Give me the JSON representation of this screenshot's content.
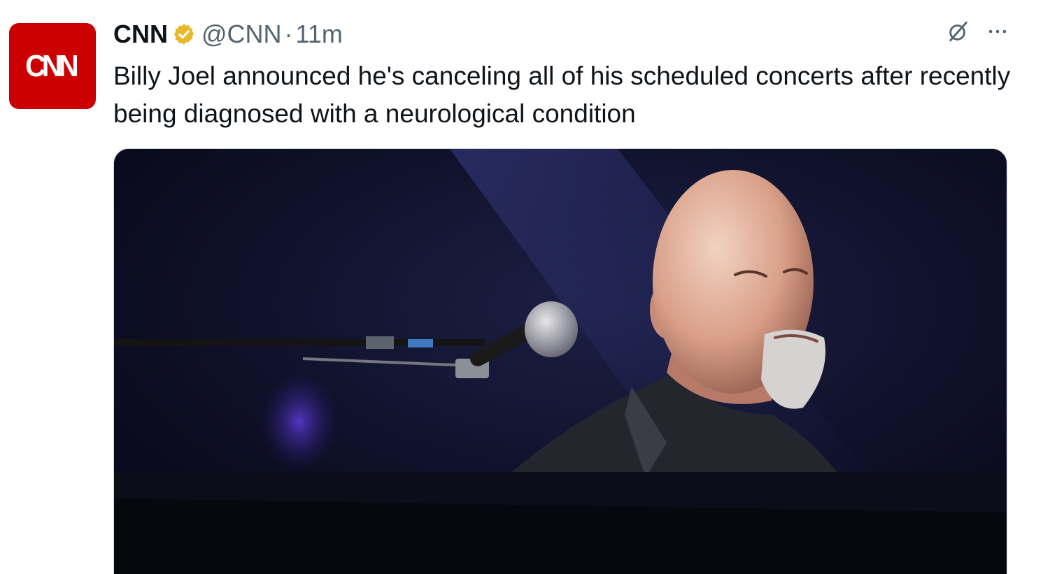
{
  "tweet": {
    "avatar_text": "CNN",
    "display_name": "CNN",
    "handle": "@CNN",
    "separator": "·",
    "time": "11m",
    "text": "Billy Joel announced he's canceling all of his scheduled concerts after recently being diagnosed with a neurological condition",
    "icons": {
      "verified": "verified-badge-icon",
      "grok": "grok-icon",
      "more": "more-options-icon"
    },
    "colors": {
      "brand_red": "#cc0000",
      "verified_gold": "#e8b829",
      "secondary_text": "#536471"
    }
  }
}
